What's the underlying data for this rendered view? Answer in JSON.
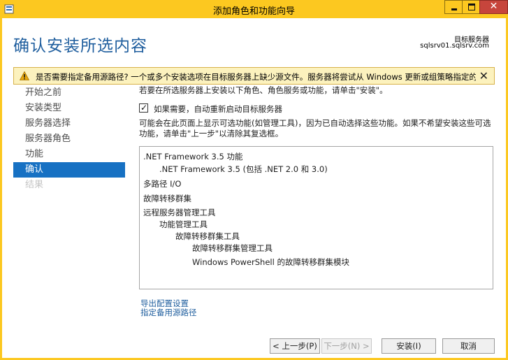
{
  "window": {
    "title": "添加角色和功能向导",
    "minimize_glyph": "",
    "maximize_glyph": "",
    "close_glyph": "✕"
  },
  "header": {
    "page_title": "确认安装所选内容",
    "server_label": "目标服务器",
    "server_name": "sqlsrv01.sqlsrv.com"
  },
  "warning": {
    "text": "是否需要指定备用源路径? 一个或多个安装选项在目标服务器上缺少源文件。服务器将尝试从 Windows 更新或组策略指定的...",
    "close_glyph": "✕",
    "icon": "warning-icon",
    "accent_color": "#fcf2be"
  },
  "nav": {
    "items": [
      {
        "label": "开始之前",
        "state": "normal"
      },
      {
        "label": "安装类型",
        "state": "normal"
      },
      {
        "label": "服务器选择",
        "state": "normal"
      },
      {
        "label": "服务器角色",
        "state": "normal"
      },
      {
        "label": "功能",
        "state": "normal"
      },
      {
        "label": "确认",
        "state": "active"
      },
      {
        "label": "结果",
        "state": "disabled"
      }
    ]
  },
  "content": {
    "intro": "若要在所选服务器上安装以下角色、角色服务或功能，请单击\"安装\"。",
    "restart_checkbox": {
      "label": "如果需要，自动重新启动目标服务器",
      "checked": true,
      "check_glyph": "✓"
    },
    "note": "可能会在此页面上显示可选功能(如管理工具)，因为已自动选择这些功能。如果不希望安装这些可选功能，请单击\"上一步\"以清除其复选框。",
    "features": [
      {
        "label": ".NET Framework 3.5 功能",
        "level": 0
      },
      {
        "label": ".NET Framework 3.5 (包括 .NET 2.0 和 3.0)",
        "level": 1
      },
      {
        "label": "多路径 I/O",
        "level": 0
      },
      {
        "label": "故障转移群集",
        "level": 0
      },
      {
        "label": "远程服务器管理工具",
        "level": 0
      },
      {
        "label": "功能管理工具",
        "level": 1
      },
      {
        "label": "故障转移群集工具",
        "level": 2
      },
      {
        "label": "故障转移群集管理工具",
        "level": 3
      },
      {
        "label": "Windows PowerShell 的故障转移群集模块",
        "level": 3
      }
    ],
    "links": {
      "export": "导出配置设置",
      "alternate_source": "指定备用源路径"
    }
  },
  "buttons": {
    "prev": "< 上一步(P)",
    "next": "下一步(N) >",
    "install": "安装(I)",
    "cancel": "取消"
  },
  "colors": {
    "title_bar": "#fcc820",
    "title_text": "#1f5e9e",
    "nav_active": "#1771c3",
    "close_button": "#c7453c"
  }
}
